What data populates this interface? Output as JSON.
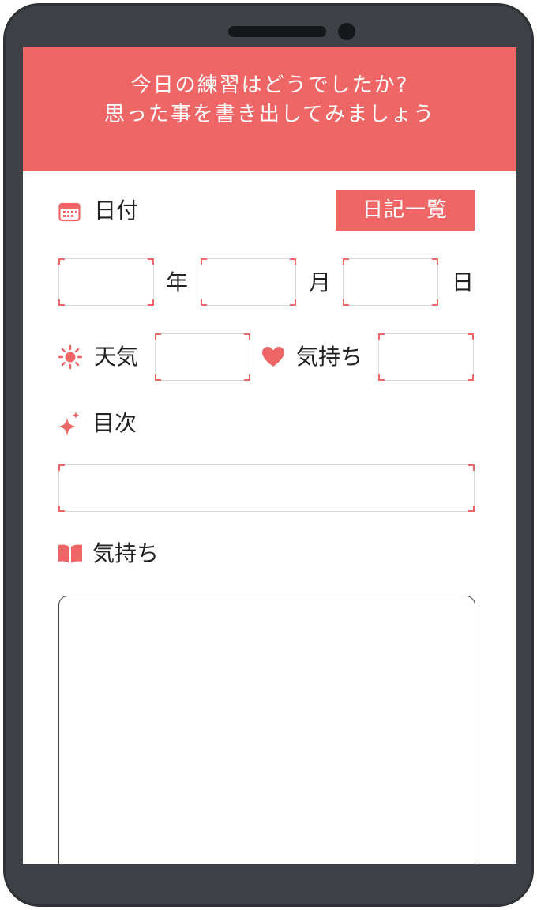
{
  "header": {
    "line1": "今日の練習はどうでしたか?",
    "line2": "思った事を書き出してみましょう"
  },
  "date_section": {
    "label": "日付",
    "icon": "calendar-icon",
    "diary_list_button": "日記一覧",
    "year_unit": "年",
    "month_unit": "月",
    "day_unit": "日",
    "year_value": "",
    "month_value": "",
    "day_value": ""
  },
  "weather": {
    "label": "天気",
    "icon": "sun-icon",
    "value": ""
  },
  "mood": {
    "label": "気持ち",
    "icon": "heart-icon",
    "value": ""
  },
  "goal": {
    "label": "目次",
    "icon": "sparkle-icon",
    "value": ""
  },
  "feelings": {
    "label": "気持ち",
    "icon": "book-icon",
    "value": ""
  },
  "colors": {
    "accent": "#ee6766",
    "phone_body": "#3e4146",
    "text": "#222222"
  }
}
